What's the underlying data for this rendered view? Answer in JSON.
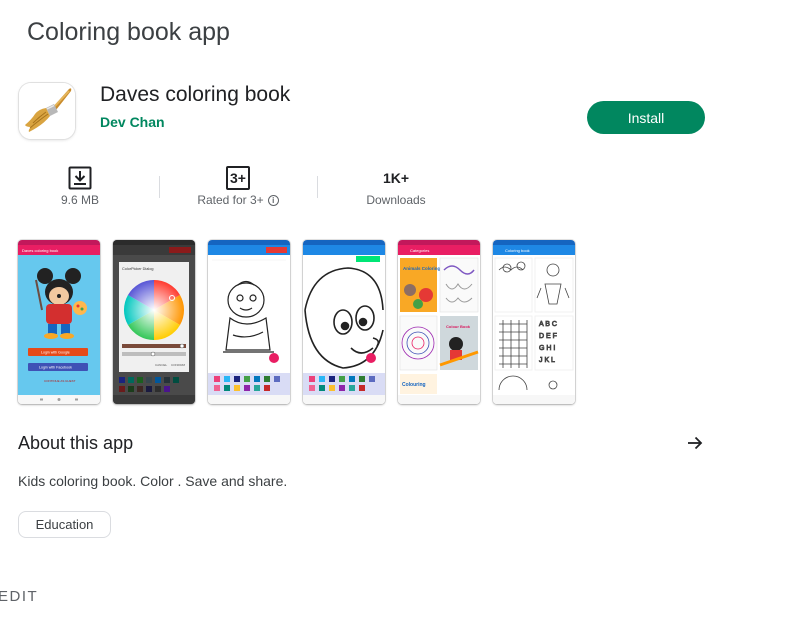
{
  "page": {
    "heading": "Coloring book app"
  },
  "app": {
    "name": "Daves coloring book",
    "developer": "Dev Chan",
    "icon": "paintbrush-icon",
    "install_label": "Install",
    "accent_color": "#01875f"
  },
  "stats": [
    {
      "top": "",
      "icon": "download-icon",
      "label": "9.6 MB"
    },
    {
      "top": "3+",
      "icon": "rating-box-icon",
      "label": "Rated for 3+",
      "info_icon": "info-icon"
    },
    {
      "top": "1K+",
      "label": "Downloads"
    }
  ],
  "screenshots": [
    {
      "name": "screenshot-login",
      "title": "Daves coloring book",
      "buttons": [
        "Login with Google",
        "Login with Facebook"
      ],
      "footer": "CONTINUE AS GUEST"
    },
    {
      "name": "screenshot-color-picker",
      "title": "ColorPicker Dialog",
      "buttons": [
        "CANCEL",
        "CONFIRM"
      ]
    },
    {
      "name": "screenshot-coloring-baby"
    },
    {
      "name": "screenshot-coloring-closeup"
    },
    {
      "name": "screenshot-categories",
      "title": "Categories",
      "tiles": [
        "Animals Coloring",
        "Colour Book",
        "Colouring"
      ]
    },
    {
      "name": "screenshot-coloring-book",
      "title": "Coloring book"
    }
  ],
  "about": {
    "title": "About this app",
    "arrow_icon": "arrow-right-icon",
    "description": "Kids coloring book. Color . Save and share.",
    "category_chip": "Education"
  },
  "footer": {
    "edit_label": "EDIT"
  }
}
